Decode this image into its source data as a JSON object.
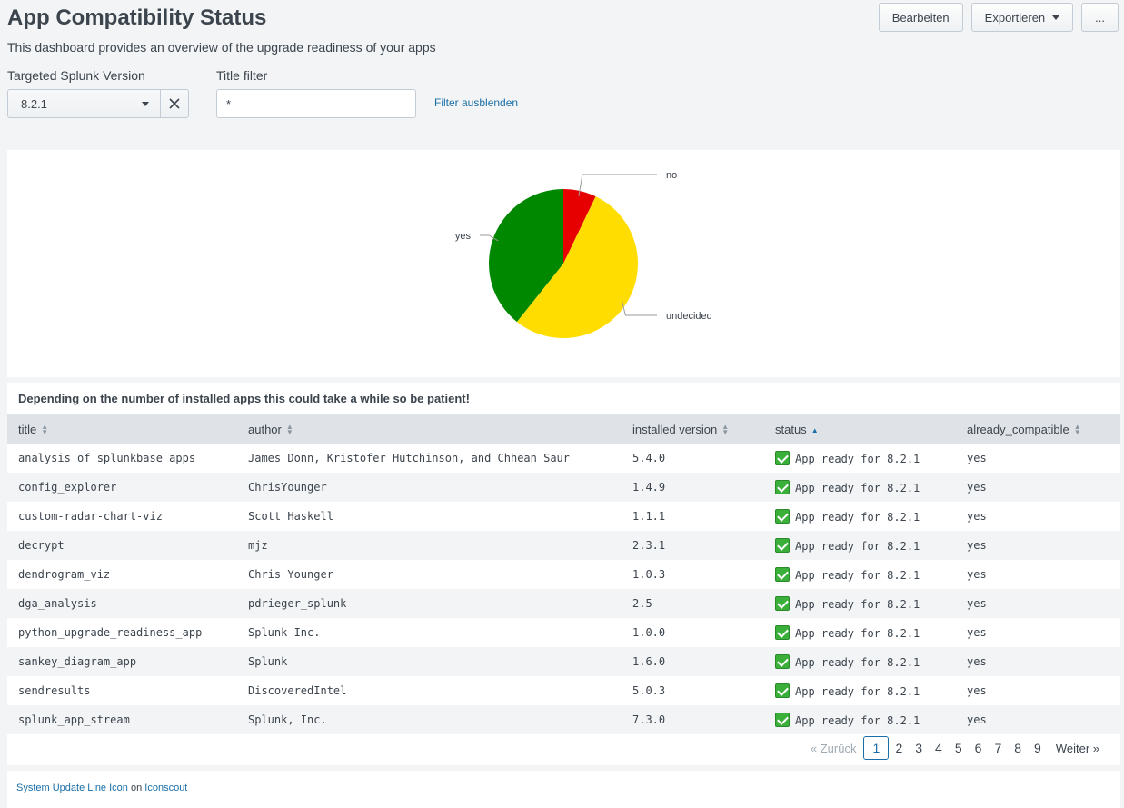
{
  "header": {
    "title": "App Compatibility Status",
    "description": "This dashboard provides an overview of the upgrade readiness of your apps",
    "edit_label": "Bearbeiten",
    "export_label": "Exportieren",
    "more_label": "..."
  },
  "filters": {
    "version_label": "Targeted Splunk Version",
    "version_value": "8.2.1",
    "title_filter_label": "Title filter",
    "title_filter_value": "*",
    "hide_filters_label": "Filter ausblenden"
  },
  "chart_data": {
    "type": "pie",
    "slices": [
      {
        "label": "no",
        "value": 1,
        "color": "#e60000"
      },
      {
        "label": "undecided",
        "value": 7.5,
        "color": "#ffdd00"
      },
      {
        "label": "yes",
        "value": 5.5,
        "color": "#008800"
      }
    ]
  },
  "table": {
    "title": "Depending on the number of installed apps this could take a while so be patient!",
    "columns": [
      "title",
      "author",
      "installed version",
      "status",
      "already_compatible"
    ],
    "rows": [
      {
        "title": "analysis_of_splunkbase_apps",
        "author": "James Donn, Kristofer Hutchinson, and Chhean Saur",
        "version": "5.4.0",
        "status": "App ready for 8.2.1",
        "compatible": "yes"
      },
      {
        "title": "config_explorer",
        "author": "ChrisYounger",
        "version": "1.4.9",
        "status": "App ready for 8.2.1",
        "compatible": "yes"
      },
      {
        "title": "custom-radar-chart-viz",
        "author": "Scott Haskell",
        "version": "1.1.1",
        "status": "App ready for 8.2.1",
        "compatible": "yes"
      },
      {
        "title": "decrypt",
        "author": "mjz",
        "version": "2.3.1",
        "status": "App ready for 8.2.1",
        "compatible": "yes"
      },
      {
        "title": "dendrogram_viz",
        "author": "Chris Younger",
        "version": "1.0.3",
        "status": "App ready for 8.2.1",
        "compatible": "yes"
      },
      {
        "title": "dga_analysis",
        "author": "pdrieger_splunk",
        "version": "2.5",
        "status": "App ready for 8.2.1",
        "compatible": "yes"
      },
      {
        "title": "python_upgrade_readiness_app",
        "author": "Splunk Inc.",
        "version": "1.0.0",
        "status": "App ready for 8.2.1",
        "compatible": "yes"
      },
      {
        "title": "sankey_diagram_app",
        "author": "Splunk",
        "version": "1.6.0",
        "status": "App ready for 8.2.1",
        "compatible": "yes"
      },
      {
        "title": "sendresults",
        "author": "DiscoveredIntel",
        "version": "5.0.3",
        "status": "App ready for 8.2.1",
        "compatible": "yes"
      },
      {
        "title": "splunk_app_stream",
        "author": "Splunk, Inc.",
        "version": "7.3.0",
        "status": "App ready for 8.2.1",
        "compatible": "yes"
      }
    ]
  },
  "pagination": {
    "prev_label": "« Zurück",
    "next_label": "Weiter »",
    "pages": [
      "1",
      "2",
      "3",
      "4",
      "5",
      "6",
      "7",
      "8",
      "9"
    ],
    "current": "1"
  },
  "footer": {
    "link1": "System Update Line Icon",
    "on": "on",
    "link2": "Iconscout"
  }
}
